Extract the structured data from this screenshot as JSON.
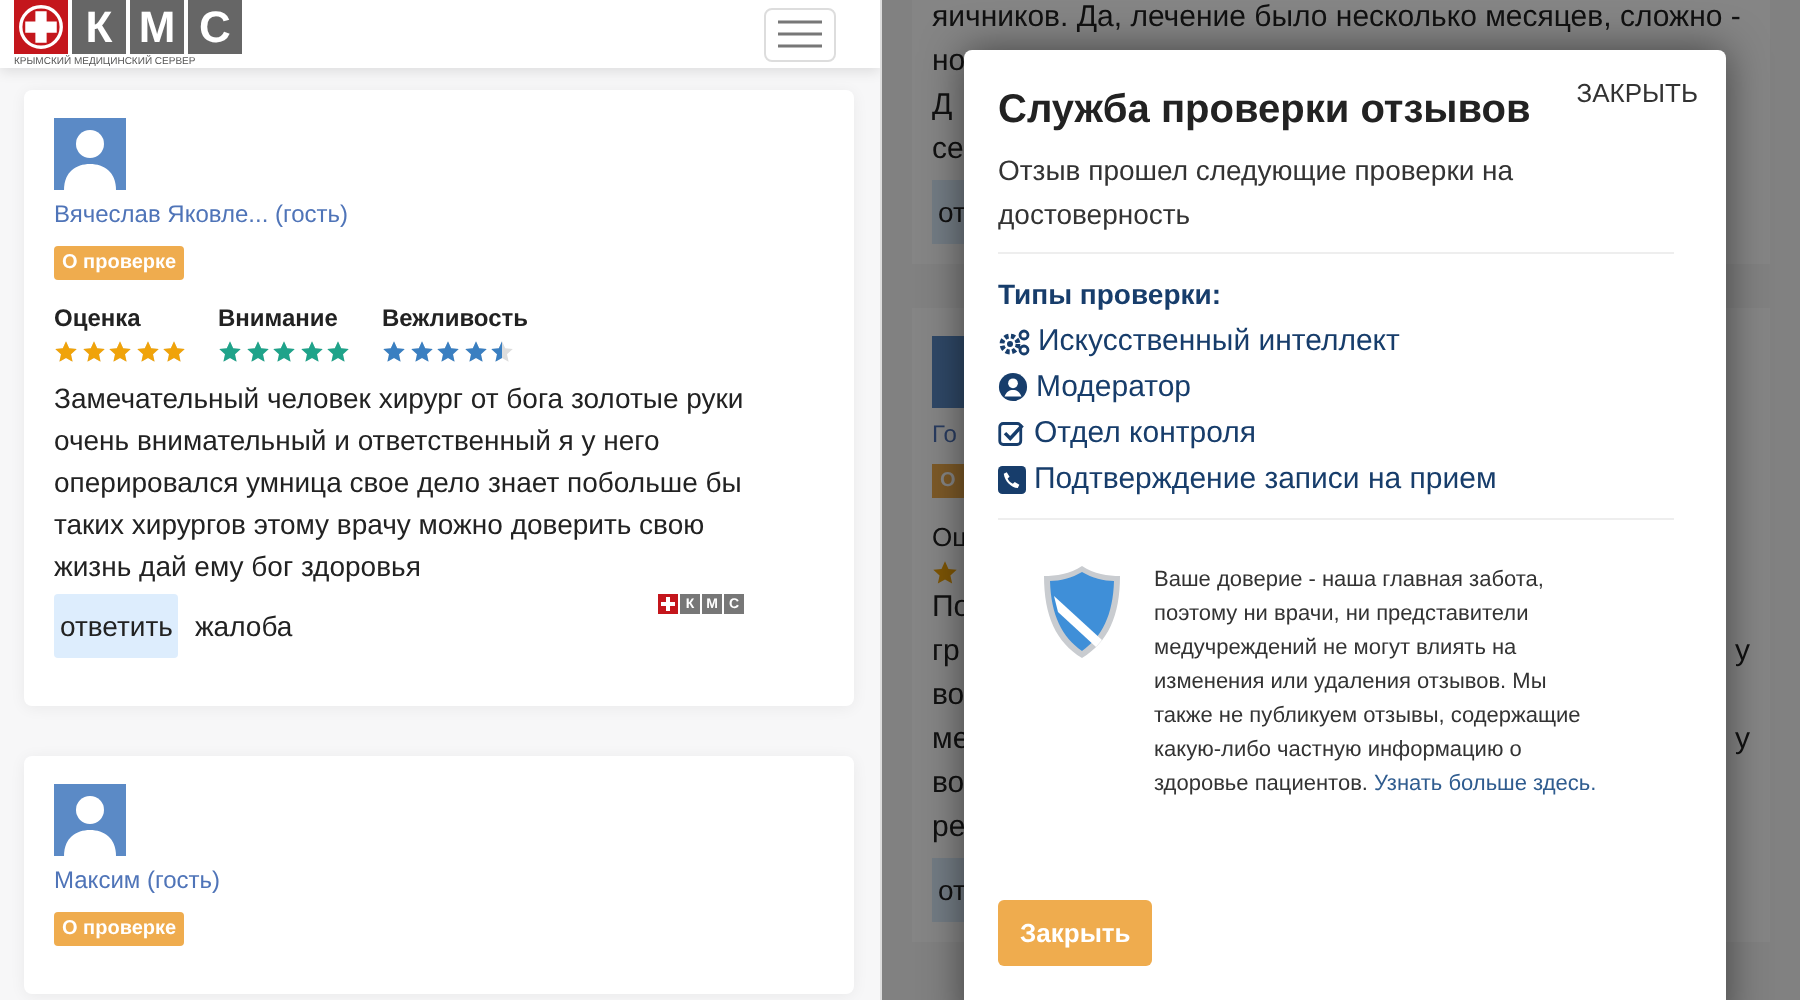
{
  "header": {
    "logo": {
      "letters": [
        "К",
        "М",
        "С"
      ],
      "caption": "КРЫМСКИЙ МЕДИЦИНСКИЙ СЕРВЕР"
    }
  },
  "reviews": [
    {
      "author": "Вячеслав Яковле... (гость)",
      "badge": "О проверке",
      "ratings": [
        {
          "label": "Оценка",
          "stars": 5,
          "color": "#f0a30a"
        },
        {
          "label": "Внимание",
          "stars": 5,
          "color": "#1fa38a"
        },
        {
          "label": "Вежливость",
          "stars": 4.5,
          "color": "#3a7fc1"
        }
      ],
      "text": "Замечательный человек хирург от бога золотые руки очень внимательный и ответственный я у него оперировался умница свое дело знает побольше бы таких хирургов этому врачу можно доверить свою жизнь дай ему бог здоровья",
      "actions": [
        {
          "label": "ответить",
          "selected": true
        },
        {
          "label": "жалоба",
          "selected": false
        }
      ],
      "logo_letters": [
        "К",
        "М",
        "С"
      ]
    },
    {
      "author": "Максим (гость)",
      "badge": "О проверке"
    }
  ],
  "background_page": {
    "cards": [
      {
        "lines": [
          {
            "left": "яичников. Да, лечение было несколько месяцев, сложно -"
          },
          {
            "left": "но"
          },
          {
            "left": "Д"
          },
          {
            "left": "се"
          }
        ],
        "reply": "от"
      },
      {
        "author": "Го",
        "badge": "О",
        "rating_label": "Оц",
        "lines": [
          {
            "left": "По"
          },
          {
            "left": "гр",
            "right": "у"
          },
          {
            "left": "во"
          },
          {
            "left": "ме",
            "right": "у"
          },
          {
            "left": "во"
          },
          {
            "left": "ре"
          }
        ],
        "reply": "от"
      }
    ]
  },
  "modal": {
    "title": "Служба проверки отзывов",
    "close_link": "ЗАКРЫТЬ",
    "intro": "Отзыв прошел следующие проверки на достоверность",
    "checks_title": "Типы проверки:",
    "checks": [
      {
        "kind": "ai",
        "label": "Искусственный интеллект"
      },
      {
        "kind": "moderator",
        "label": "Модератор"
      },
      {
        "kind": "control",
        "label": "Отдел контроля"
      },
      {
        "kind": "phone",
        "label": "Подтверждение записи на прием"
      }
    ],
    "notice": "Ваше доверие - наша главная забота, поэтому ни врачи, ни представители медучреждений не могут влиять на изменения или удаления отзывов. Мы также не публикуем отзывы, содержащие какую-либо частную информацию о здоровье пациентов.",
    "notice_link": "Узнать больше здесь.",
    "close_button": "Закрыть"
  }
}
